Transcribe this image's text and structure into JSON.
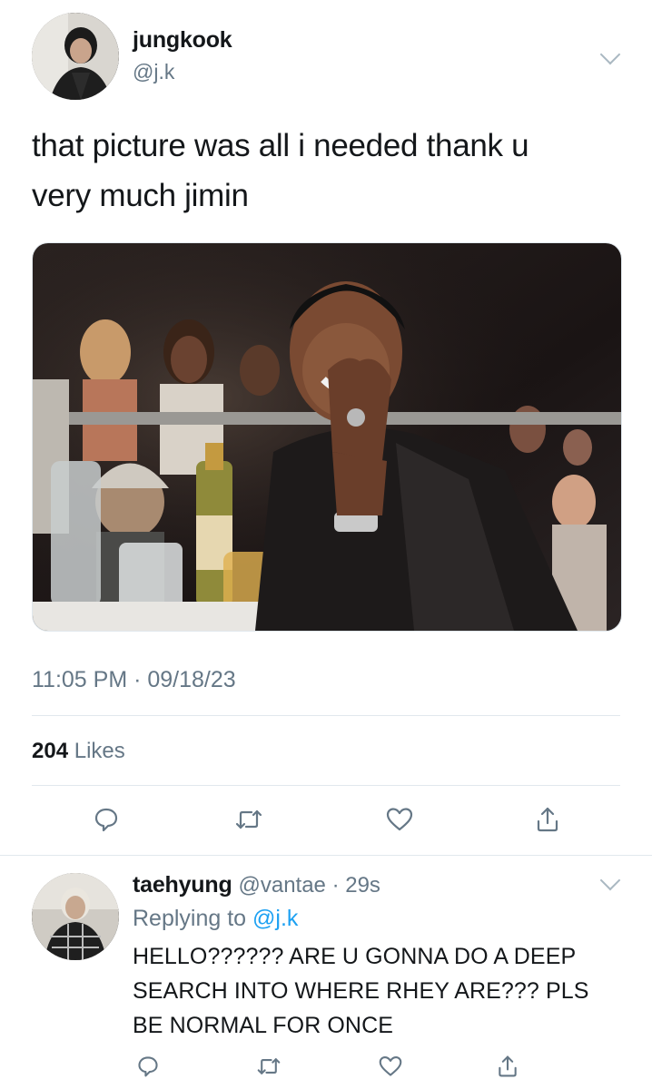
{
  "tweet": {
    "author_name": "jungkook",
    "author_handle": "@j.k",
    "text_line1": "that picture was all i needed thank u",
    "text_line2": "very much jimin",
    "time": "11:05 PM",
    "date": "09/18/23",
    "like_count": "204",
    "like_label": "Likes"
  },
  "reply": {
    "author_name": "taehyung",
    "author_handle": "@vantae",
    "time_ago": "29s",
    "replying_label": "Replying to",
    "replying_to": "@j.k",
    "text_line1": "HELLO?????? ARE U GONNA DO A DEEP",
    "text_line2": "SEARCH INTO WHERE RHEY ARE??? PLS",
    "text_line3": "BE NORMAL FOR ONCE"
  },
  "icons": [
    "chevron-down-icon",
    "reply-icon",
    "retweet-icon",
    "like-icon",
    "share-icon"
  ],
  "colors": {
    "link": "#1da1f2",
    "muted": "#657786",
    "divider": "#e1e8ed"
  }
}
